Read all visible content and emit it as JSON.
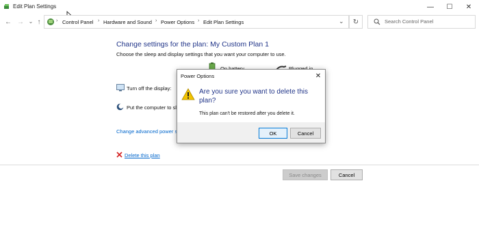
{
  "window": {
    "title": "Edit Plan Settings",
    "controls": {
      "minimize": "—",
      "maximize": "☐",
      "close": "✕"
    }
  },
  "nav": {
    "back": "←",
    "forward": "→",
    "recent": "⌄",
    "up": "↑",
    "breadcrumbs": [
      "Control Panel",
      "Hardware and Sound",
      "Power Options",
      "Edit Plan Settings"
    ],
    "separator": "›",
    "dropdown": "⌄",
    "refresh": "↻"
  },
  "search": {
    "placeholder": "Search Control Panel"
  },
  "main": {
    "heading": "Change settings for the plan: My Custom Plan 1",
    "subheading": "Choose the sleep and display settings that you want your computer to use.",
    "col_battery": "On battery",
    "col_plugged": "Plugged in",
    "display_label": "Turn off the display:",
    "sleep_label": "Put the computer to sl",
    "advanced_link": "Change advanced power se",
    "delete_link": "Delete this plan",
    "save_button": "Save changes",
    "cancel_button": "Cancel"
  },
  "dialog": {
    "title": "Power Options",
    "close": "✕",
    "question": "Are you sure you want to delete this plan?",
    "message": "This plan can't be restored after you delete it.",
    "ok": "OK",
    "cancel": "Cancel"
  },
  "colors": {
    "heading": "#1e3287",
    "link": "#0066cc",
    "warning": "#f2c400"
  }
}
